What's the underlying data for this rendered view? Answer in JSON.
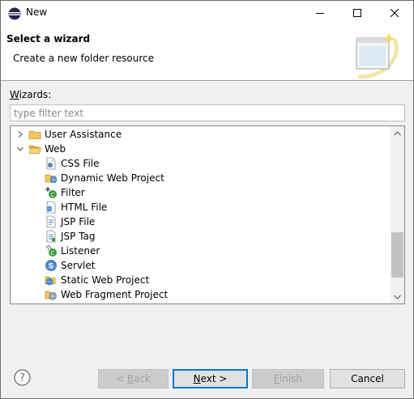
{
  "window": {
    "title": "New"
  },
  "header": {
    "title": "Select a wizard",
    "description": "Create a new folder resource"
  },
  "wizards": {
    "label_prefix": "",
    "label_mnemonic": "W",
    "label_rest": "izards:",
    "filter_placeholder": "type filter text",
    "filter_value": ""
  },
  "tree": {
    "items": [
      {
        "label": "User Assistance",
        "icon": "folder-icon",
        "expanded": false
      },
      {
        "label": "Web",
        "icon": "folder-open-icon",
        "expanded": true
      },
      {
        "label": "CSS File",
        "icon": "css-file-icon"
      },
      {
        "label": "Dynamic Web Project",
        "icon": "dynamic-web-project-icon"
      },
      {
        "label": "Filter",
        "icon": "filter-icon"
      },
      {
        "label": "HTML File",
        "icon": "html-file-icon"
      },
      {
        "label": "JSP File",
        "icon": "jsp-file-icon"
      },
      {
        "label": "JSP Tag",
        "icon": "jsp-tag-icon"
      },
      {
        "label": "Listener",
        "icon": "listener-icon"
      },
      {
        "label": "Servlet",
        "icon": "servlet-icon"
      },
      {
        "label": "Static Web Project",
        "icon": "static-web-project-icon"
      },
      {
        "label": "Web Fragment Project",
        "icon": "web-fragment-project-icon"
      }
    ]
  },
  "buttons": {
    "back_arrow": "< ",
    "back_mnemonic": "B",
    "back_rest": "ack",
    "next_mnemonic": "N",
    "next_rest": "ext >",
    "finish_mnemonic": "F",
    "finish_rest": "inish",
    "cancel": "Cancel"
  },
  "colors": {
    "accent": "#0078d7",
    "folder": "#e8b84a",
    "selection_border": "#0078d7"
  }
}
